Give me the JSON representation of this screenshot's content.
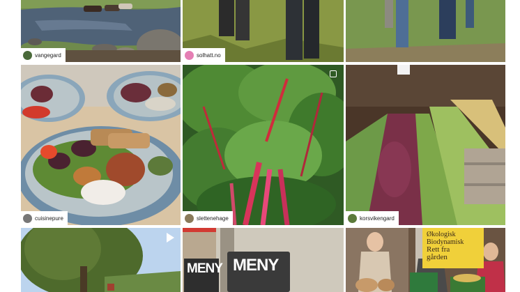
{
  "feed": {
    "tiles": [
      {
        "username": "vangegard",
        "avatar_color": "#4a6a3a"
      },
      {
        "username": "solhatt.no",
        "avatar_color": "#e57fb4"
      },
      {
        "username": "",
        "avatar_color": ""
      },
      {
        "username": "cuisinepure",
        "avatar_color": "#777777"
      },
      {
        "username": "slettenehage",
        "avatar_color": "#8a7a5a"
      },
      {
        "username": "korsvikengard",
        "avatar_color": "#5b7a3a"
      },
      {
        "username": "",
        "avatar_color": ""
      },
      {
        "username": "",
        "avatar_color": ""
      },
      {
        "username": "",
        "avatar_color": ""
      }
    ],
    "signs": {
      "meny_left": "MENY",
      "meny_right": "MENY",
      "shop_line1": "Økologisk",
      "shop_line2": "Biodynamisk",
      "shop_line3": "Rett fra",
      "shop_line4": "gården"
    }
  }
}
